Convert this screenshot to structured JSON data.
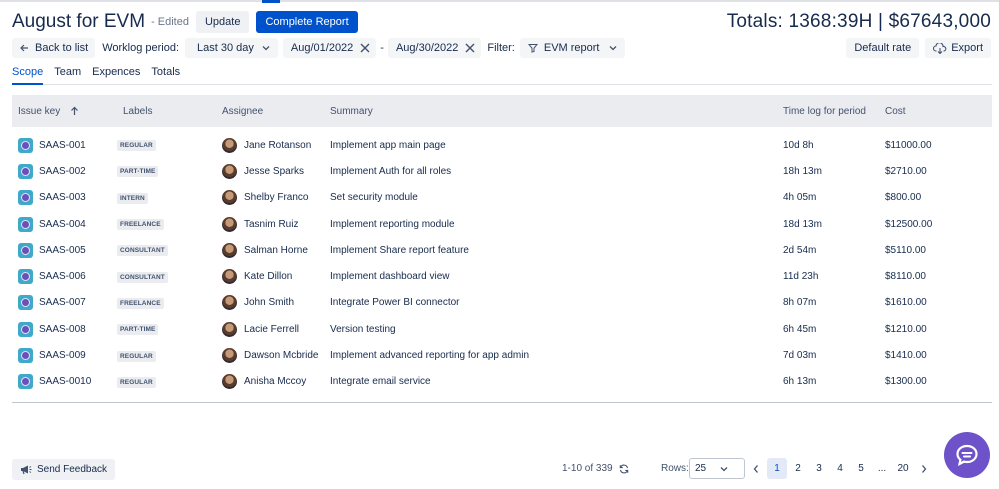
{
  "header": {
    "title": "August for EVM",
    "edited": "- Edited",
    "update_label": "Update",
    "complete_label": "Complete Report",
    "totals": "Totals: 1368:39H | $67643,000"
  },
  "toolbar": {
    "back_label": "Back to list",
    "worklog_label": "Worklog period:",
    "period_value": "Last 30 day",
    "date_from": "Aug/01/2022",
    "dash": "-",
    "date_to": "Aug/30/2022",
    "filter_label": "Filter:",
    "filter_value": "EVM report",
    "default_rate": "Default rate",
    "export_label": "Export"
  },
  "tabs": [
    "Scope",
    "Team",
    "Expences",
    "Totals"
  ],
  "table": {
    "headers": {
      "issue_key": "Issue key",
      "labels": "Labels",
      "assignee": "Assignee",
      "summary": "Summary",
      "time": "Time log for period",
      "cost": "Cost"
    },
    "rows": [
      {
        "key": "SAAS-001",
        "label": "REGULAR",
        "assignee": "Jane Rotanson",
        "summary": "Implement app main page",
        "time": "10d 8h",
        "cost": "$11000.00"
      },
      {
        "key": "SAAS-002",
        "label": "PART-TIME",
        "assignee": "Jesse Sparks",
        "summary": "Implement Auth for all roles",
        "time": "18h 13m",
        "cost": "$2710.00"
      },
      {
        "key": "SAAS-003",
        "label": "INTERN",
        "assignee": "Shelby Franco",
        "summary": "Set security module",
        "time": "4h 05m",
        "cost": "$800.00"
      },
      {
        "key": "SAAS-004",
        "label": "FREELANCE",
        "assignee": "Tasnim Ruiz",
        "summary": "Implement reporting module",
        "time": "18d 13m",
        "cost": "$12500.00"
      },
      {
        "key": "SAAS-005",
        "label": "CONSULTANT",
        "assignee": "Salman Horne",
        "summary": "Implement Share report feature",
        "time": "2d 54m",
        "cost": "$5110.00"
      },
      {
        "key": "SAAS-006",
        "label": "CONSULTANT",
        "assignee": "Kate Dillon",
        "summary": "Implement dashboard view",
        "time": "11d 23h",
        "cost": "$8110.00"
      },
      {
        "key": "SAAS-007",
        "label": "FREELANCE",
        "assignee": "John Smith",
        "summary": "Integrate Power BI connector",
        "time": "8h 07m",
        "cost": "$1610.00"
      },
      {
        "key": "SAAS-008",
        "label": "PART-TIME",
        "assignee": "Lacie Ferrell",
        "summary": "Version testing",
        "time": "6h 45m",
        "cost": "$1210.00"
      },
      {
        "key": "SAAS-009",
        "label": "REGULAR",
        "assignee": "Dawson Mcbride",
        "summary": "Implement advanced reporting for app admin",
        "time": "7d 03m",
        "cost": "$1410.00"
      },
      {
        "key": "SAAS-0010",
        "label": "REGULAR",
        "assignee": "Anisha Mccoy",
        "summary": "Integrate email service",
        "time": "6h 13m",
        "cost": "$1300.00"
      }
    ]
  },
  "footer": {
    "feedback_label": "Send Feedback",
    "range": "1-10 of 339",
    "rows_label": "Rows:",
    "rows_value": "25",
    "pages": [
      "1",
      "2",
      "3",
      "4",
      "5",
      "...",
      "20"
    ]
  },
  "icons": {
    "back": "arrow-left-icon",
    "chevron": "chevron-down-icon",
    "clear": "close-icon",
    "filter": "filter-icon",
    "export": "cloud-download-icon",
    "sort": "arrow-up-icon",
    "issue": "jira-issue-icon",
    "avatar": "user-avatar",
    "feedback": "megaphone-icon",
    "refresh": "refresh-icon",
    "chat": "chat-icon"
  },
  "colors": {
    "primary": "#0052cc",
    "chat": "#6d52c9",
    "header_bg": "#ebecf0"
  }
}
